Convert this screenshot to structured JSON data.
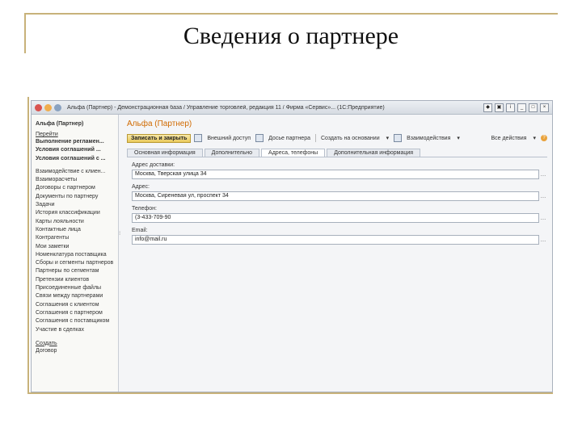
{
  "slide": {
    "title": "Сведения о партнере"
  },
  "window": {
    "title": "Альфа (Партнер) - Демонстрационная база / Управление торговлей, редакция 11 / Фирма «Сервис»... (1С:Предприятие)"
  },
  "sidebar": {
    "header": "Альфа (Партнер)",
    "goto_label": "Перейти",
    "bold_items": [
      "Выполнение регламен...",
      "Условия соглашений ...",
      "Условия соглашений с ..."
    ],
    "items": [
      "Взаимодействие с клиен...",
      "Взаиморасчеты",
      "Договоры с партнером",
      "Документы по партнеру",
      "Задачи",
      "История классификации",
      "Карты лояльности",
      "Контактные лица",
      "Контрагенты",
      "Мои заметки",
      "Номенклатура поставщика",
      "Сборы и сегменты партнеров",
      "Партнеры по сегментам",
      "Претензии клиентов",
      "Присоединенные файлы",
      "Связи между партнерами",
      "Соглашения с клиентом",
      "Соглашения с партнером",
      "Соглашения с поставщиком",
      "Участие в сделках"
    ],
    "footer_section": "Создать",
    "footer_item": "Договор"
  },
  "form": {
    "title": "Альфа (Партнер)",
    "toolbar": {
      "save_close": "Записать и закрыть",
      "external_access": "Внешний доступ",
      "partner_dossier": "Досье партнера",
      "create_based": "Создать на основании",
      "interactions": "Взаимодействия",
      "actions": "Все действия"
    },
    "tabs": [
      "Основная информация",
      "Дополнительно",
      "Адреса, телефоны",
      "Дополнительная информация"
    ],
    "active_tab": 2,
    "fields": [
      {
        "label": "Адрес доставки:",
        "value": "Москва, Тверская улица 34"
      },
      {
        "label": "Адрес:",
        "value": "Москва, Сиреневая ул, проспект 34"
      },
      {
        "label": "Телефон:",
        "value": "(3-433-709-90"
      },
      {
        "label": "Email:",
        "value": "info@mail.ru"
      }
    ]
  }
}
